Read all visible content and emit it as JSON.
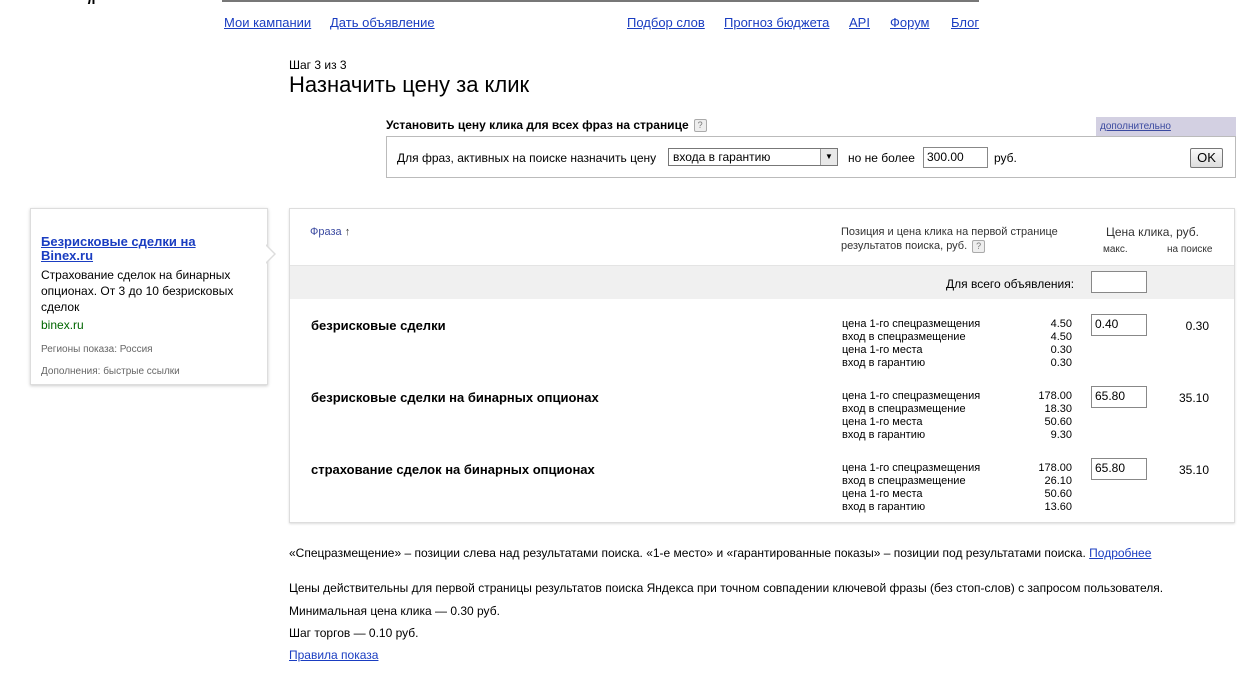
{
  "nav": {
    "left": [
      "Мои кампании",
      "Дать объявление"
    ],
    "right": [
      "Подбор слов",
      "Прогноз бюджета",
      "API",
      "Форум",
      "Блог"
    ]
  },
  "step": "Шаг 3 из 3",
  "title": "Назначить цену за клик",
  "settings": {
    "title": "Установить цену клика для всех фраз на странице",
    "more_link": "дополнительно",
    "label_for": "Для фраз, активных на поиске назначить цену",
    "select_value": "входа в гарантию",
    "label_max": "но не более",
    "max_value": "300.00",
    "currency": "руб.",
    "ok": "OK"
  },
  "ad": {
    "title": "Безрисковые сделки на Binex.ru",
    "text": "Страхование сделок на бинарных опционах. От 3 до 10 безрисковых сделок",
    "domain": "binex.ru",
    "regions": "Регионы показа: Россия",
    "extras": "Дополнения: быстрые ссылки"
  },
  "table": {
    "col_phrase": "Фраза",
    "sort_arrow": "↑",
    "col_position": "Позиция и цена клика на первой странице результатов поиска, руб.",
    "col_price": "Цена клика, руб.",
    "col_max": "макс.",
    "col_search": "на поиске",
    "whole_ad_label": "Для всего объявления:",
    "whole_ad_value": "",
    "rows": [
      {
        "phrase": "безрисковые сделки",
        "positions": [
          {
            "label": "цена 1-го спецразмещения",
            "value": "4.50"
          },
          {
            "label": "вход в спецразмещение",
            "value": "4.50"
          },
          {
            "label": "цена 1-го места",
            "value": "0.30"
          },
          {
            "label": "вход в гарантию",
            "value": "0.30"
          }
        ],
        "max": "0.40",
        "search": "0.30"
      },
      {
        "phrase": "безрисковые сделки на бинарных опционах",
        "positions": [
          {
            "label": "цена 1-го спецразмещения",
            "value": "178.00"
          },
          {
            "label": "вход в спецразмещение",
            "value": "18.30"
          },
          {
            "label": "цена 1-го места",
            "value": "50.60"
          },
          {
            "label": "вход в гарантию",
            "value": "9.30"
          }
        ],
        "max": "65.80",
        "search": "35.10"
      },
      {
        "phrase": "страхование сделок на бинарных опционах",
        "positions": [
          {
            "label": "цена 1-го спецразмещения",
            "value": "178.00"
          },
          {
            "label": "вход в спецразмещение",
            "value": "26.10"
          },
          {
            "label": "цена 1-го места",
            "value": "50.60"
          },
          {
            "label": "вход в гарантию",
            "value": "13.60"
          }
        ],
        "max": "65.80",
        "search": "35.10"
      }
    ]
  },
  "footer": {
    "note": "«Спецразмещение» – позиции слева над результатами поиска. «1-е место» и «гарантированные показы» – позиции под результатами поиска.",
    "more_link": "Подробнее",
    "validity": "Цены действительны для первой страницы результатов поиска Яндекса при точном совпадении ключевой фразы (без стоп-слов) с запросом пользователя.",
    "min_price": "Минимальная цена клика — 0.30 руб.",
    "step": "Шаг торгов — 0.10 руб.",
    "rules_link": "Правила показа"
  }
}
